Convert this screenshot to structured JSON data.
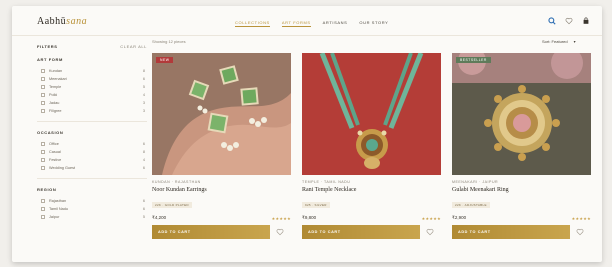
{
  "brand": {
    "name": "Aabhū",
    "accent": "sana"
  },
  "nav": [
    "COLLECTIONS",
    "ART FORMS",
    "ARTISANS",
    "OUR STORY"
  ],
  "nav_active": [
    0,
    1
  ],
  "header_icons": [
    "search-icon",
    "heart-icon",
    "bag-icon"
  ],
  "sidebar": {
    "title": "FILTERS",
    "clear": "CLEAR ALL",
    "sections": [
      {
        "title": "ART FORM",
        "options": [
          {
            "label": "Kundan",
            "count": "8"
          },
          {
            "label": "Meenakari",
            "count": "6"
          },
          {
            "label": "Temple",
            "count": "5"
          },
          {
            "label": "Polki",
            "count": "4"
          },
          {
            "label": "Jadau",
            "count": "3"
          },
          {
            "label": "Filigree",
            "count": "3"
          }
        ]
      },
      {
        "title": "OCCASION",
        "options": [
          {
            "label": "Office",
            "count": "6"
          },
          {
            "label": "Casual",
            "count": "8"
          },
          {
            "label": "Festive",
            "count": "4"
          },
          {
            "label": "Wedding Guest",
            "count": "6"
          }
        ]
      },
      {
        "title": "REGION",
        "options": [
          {
            "label": "Rajasthan",
            "count": "6"
          },
          {
            "label": "Tamil Nadu",
            "count": "6"
          },
          {
            "label": "Jaipur",
            "count": "5"
          }
        ]
      }
    ]
  },
  "toolbar": {
    "showing": "Showing 12 pieces",
    "sort": "Sort: Featured",
    "sort_chevron": "▾"
  },
  "products": [
    {
      "badge": "NEW",
      "badge_color": "#b23a3a",
      "category": "KUNDAN · RAJASTHAN",
      "name": "Noor Kundan Earrings",
      "tag": "22K · GOLD PLATED",
      "price": "₹4,200",
      "stars": "★★★★★",
      "cart": "ADD TO CART"
    },
    {
      "badge": "",
      "badge_color": "",
      "category": "TEMPLE · TAMIL NADU",
      "name": "Rani Temple Necklace",
      "tag": "925 · SILVER",
      "price": "₹9,800",
      "stars": "★★★★★",
      "cart": "ADD TO CART"
    },
    {
      "badge": "BESTSELLER",
      "badge_color": "#5f7b5a",
      "category": "MEENAKARI · JAIPUR",
      "name": "Gulabi Meenakari Ring",
      "tag": "22K · ADJUSTABLE",
      "price": "₹2,900",
      "stars": "★★★★★",
      "cart": "ADD TO CART"
    }
  ]
}
